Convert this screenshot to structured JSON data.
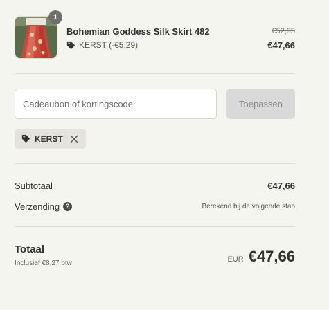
{
  "product": {
    "quantity": "1",
    "name": "Bohemian Goddess Silk Skirt 482",
    "discount_label": "KERST (-€5,29)",
    "price_original": "€52,95",
    "price_final": "€47,66",
    "image_icon": "skirt-thumbnail"
  },
  "discount_form": {
    "placeholder": "Cadeaubon of kortingscode",
    "apply_label": "Toepassen"
  },
  "applied_code": {
    "code": "KERST",
    "remove_icon": "close-icon"
  },
  "summary": {
    "subtotal_label": "Subtotaal",
    "subtotal_value": "€47,66",
    "shipping_label": "Verzending",
    "shipping_value": "Berekend bij de volgende stap",
    "help_icon": "question-icon"
  },
  "total": {
    "label": "Totaal",
    "tax_note": "Inclusief €8,27 btw",
    "currency": "EUR",
    "amount": "€47,66"
  },
  "colors": {
    "background": "#f5f5f0",
    "button_disabled": "#d9d9d9",
    "chip": "#e4e4dd"
  }
}
